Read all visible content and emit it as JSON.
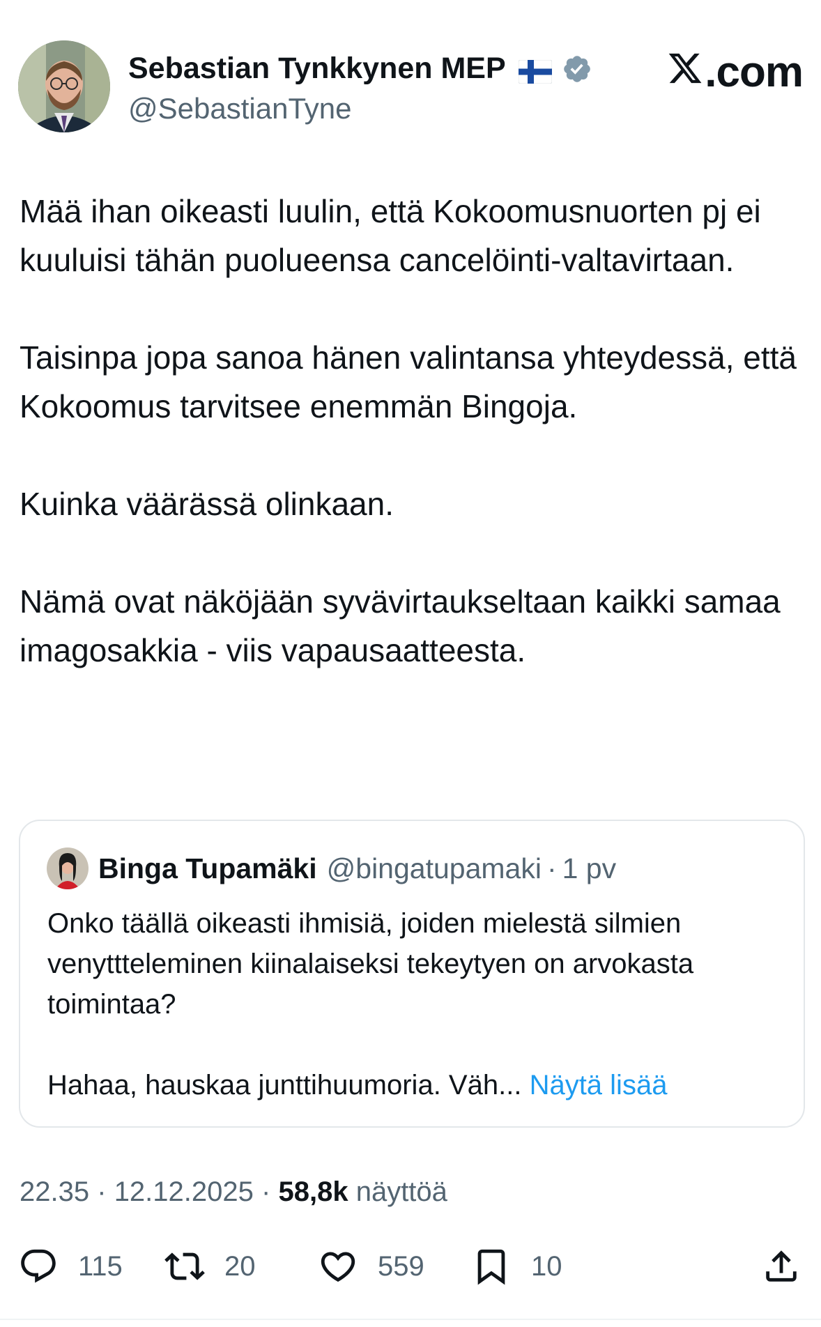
{
  "author": {
    "name": "Sebastian Tynkkynen MEP",
    "handle": "@SebastianTyne"
  },
  "brand": {
    "logo_text": ".com"
  },
  "post": {
    "paragraphs": [
      "Mää ihan oikeasti luulin, että Kokoomusnuorten pj ei kuuluisi tähän puolueensa cancelöinti-valtavirtaan.",
      "Taisinpa jopa sanoa hänen valintansa yhteydessä, että Kokoomus tarvitsee enemmän Bingoja.",
      "Kuinka väärässä olinkaan.",
      "Nämä ovat näköjään syvävirtaukseltaan kaikki samaa imagosakkia - viis vapausaatteesta."
    ]
  },
  "quoted": {
    "name": "Binga Tupamäki",
    "handle": "@bingatupamaki",
    "separator": "·",
    "time": "1 pv",
    "paragraphs": [
      "Onko täällä oikeasti ihmisiä, joiden mielestä silmien venyttteleminen kiinalaiseksi tekeytyen on arvokasta toimintaa?"
    ],
    "truncated": "Hahaa, hauskaa junttihuumoria. Väh...",
    "show_more": "Näytä lisää"
  },
  "meta": {
    "time": "22.35",
    "date": "12.12.2025",
    "separator": "·",
    "views": "58,8k",
    "views_label": "näyttöä"
  },
  "actions": {
    "replies": "115",
    "reposts": "20",
    "likes": "559",
    "bookmarks": "10"
  },
  "colors": {
    "text": "#0f1419",
    "secondary": "#536471",
    "link": "#1d9bf0",
    "verified": "#829aab",
    "border": "#e3e7ea"
  },
  "icons": [
    "avatar",
    "finland-flag-icon",
    "verified-badge-icon",
    "x-logo-icon",
    "reply-icon",
    "repost-icon",
    "like-icon",
    "bookmark-icon",
    "share-icon"
  ]
}
